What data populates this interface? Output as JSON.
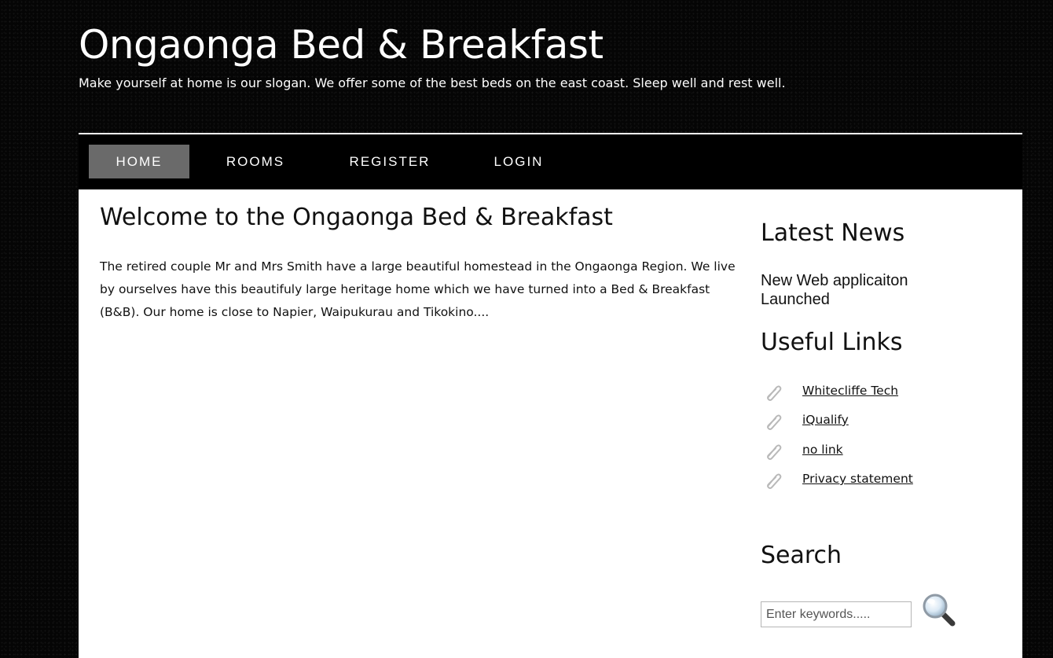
{
  "header": {
    "site_title": "Ongaonga Bed & Breakfast",
    "slogan": "Make yourself at home is our slogan. We offer some of the best beds on the east coast. Sleep well and rest well."
  },
  "nav": {
    "items": [
      {
        "label": "HOME",
        "active": true
      },
      {
        "label": "ROOMS",
        "active": false
      },
      {
        "label": "REGISTER",
        "active": false
      },
      {
        "label": "LOGIN",
        "active": false
      }
    ],
    "active_color": "#6a6a6a"
  },
  "main": {
    "heading": "Welcome to the Ongaonga Bed & Breakfast",
    "intro": "The retired couple Mr and Mrs Smith have a large beautiful homestead in the Ongaonga Region. We live by ourselves have this beautifuly large heritage home which we have turned into a Bed & Breakfast (B&B). Our home is close to Napier, Waipukurau and Tikokino...."
  },
  "sidebar": {
    "news_heading": "Latest News",
    "news_item": "New Web applicaiton Launched",
    "links_heading": "Useful Links",
    "links": [
      {
        "label": "Whitecliffe Tech",
        "icon": "paperclip-icon"
      },
      {
        "label": "iQualify",
        "icon": "paperclip-icon"
      },
      {
        "label": "no link",
        "icon": "paperclip-icon"
      },
      {
        "label": "Privacy statement",
        "icon": "paperclip-icon"
      }
    ],
    "search_heading": "Search",
    "search_placeholder": "Enter keywords.....",
    "search_icon": "magnifier-icon"
  }
}
